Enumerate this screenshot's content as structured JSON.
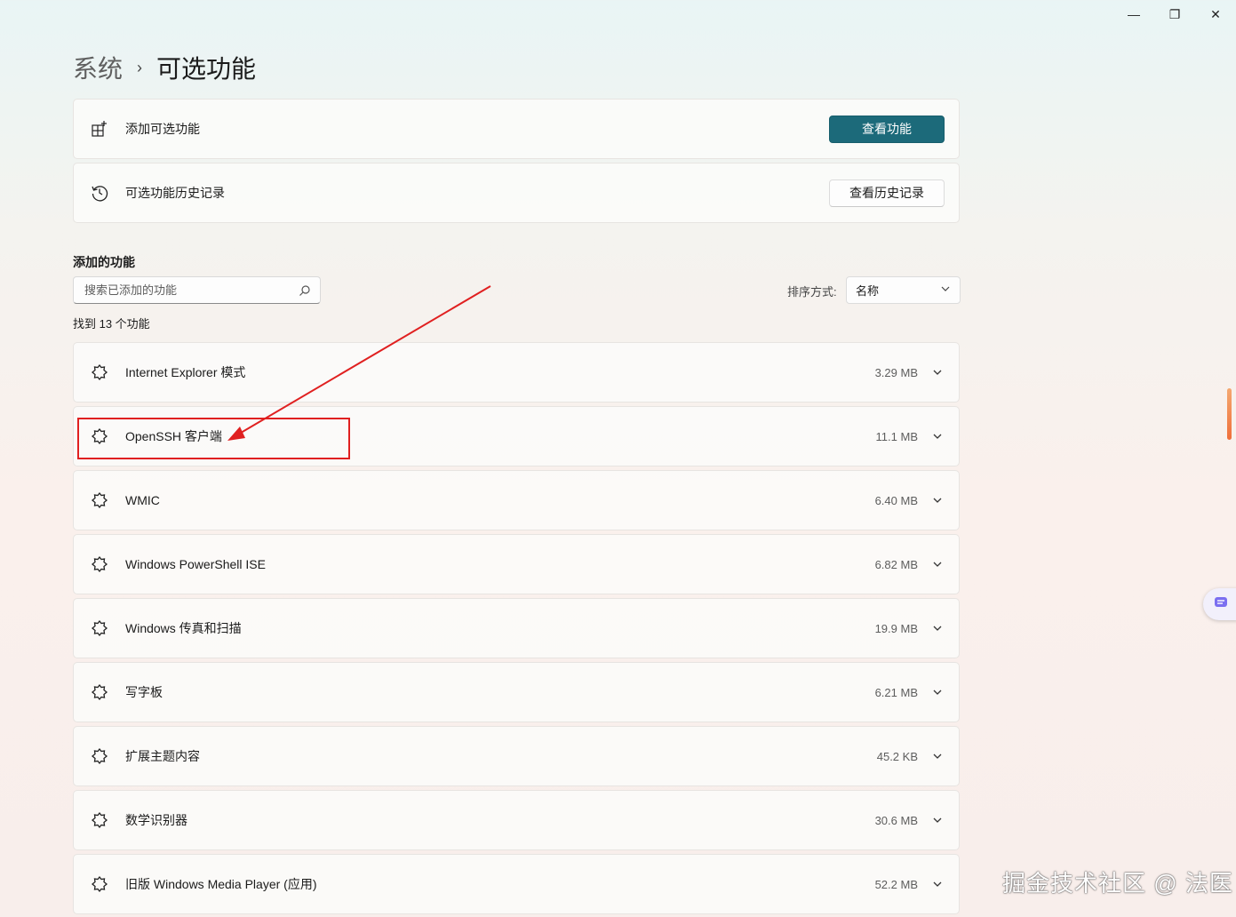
{
  "window": {
    "minimize": "—",
    "maximize": "❐",
    "close": "✕"
  },
  "breadcrumb": {
    "parent": "系统",
    "separator": "›",
    "current": "可选功能"
  },
  "add_feature": {
    "label": "添加可选功能",
    "button": "查看功能"
  },
  "history": {
    "label": "可选功能历史记录",
    "button": "查看历史记录"
  },
  "added": {
    "title": "添加的功能",
    "search_placeholder": "搜索已添加的功能",
    "sort_label": "排序方式:",
    "sort_value": "名称",
    "count_text": "找到 13 个功能",
    "features": [
      {
        "name": "Internet Explorer 模式",
        "size": "3.29 MB"
      },
      {
        "name": "OpenSSH 客户端",
        "size": "11.1 MB"
      },
      {
        "name": "WMIC",
        "size": "6.40 MB"
      },
      {
        "name": "Windows PowerShell ISE",
        "size": "6.82 MB"
      },
      {
        "name": "Windows 传真和扫描",
        "size": "19.9 MB"
      },
      {
        "name": "写字板",
        "size": "6.21 MB"
      },
      {
        "name": "扩展主题内容",
        "size": "45.2 KB"
      },
      {
        "name": "数学识别器",
        "size": "30.6 MB"
      },
      {
        "name": "旧版 Windows Media Player (应用)",
        "size": "52.2 MB"
      }
    ]
  },
  "watermark": "掘金技术社区 @ 法医",
  "colors": {
    "accent": "#1c6a7a",
    "annotation": "#e02020"
  }
}
